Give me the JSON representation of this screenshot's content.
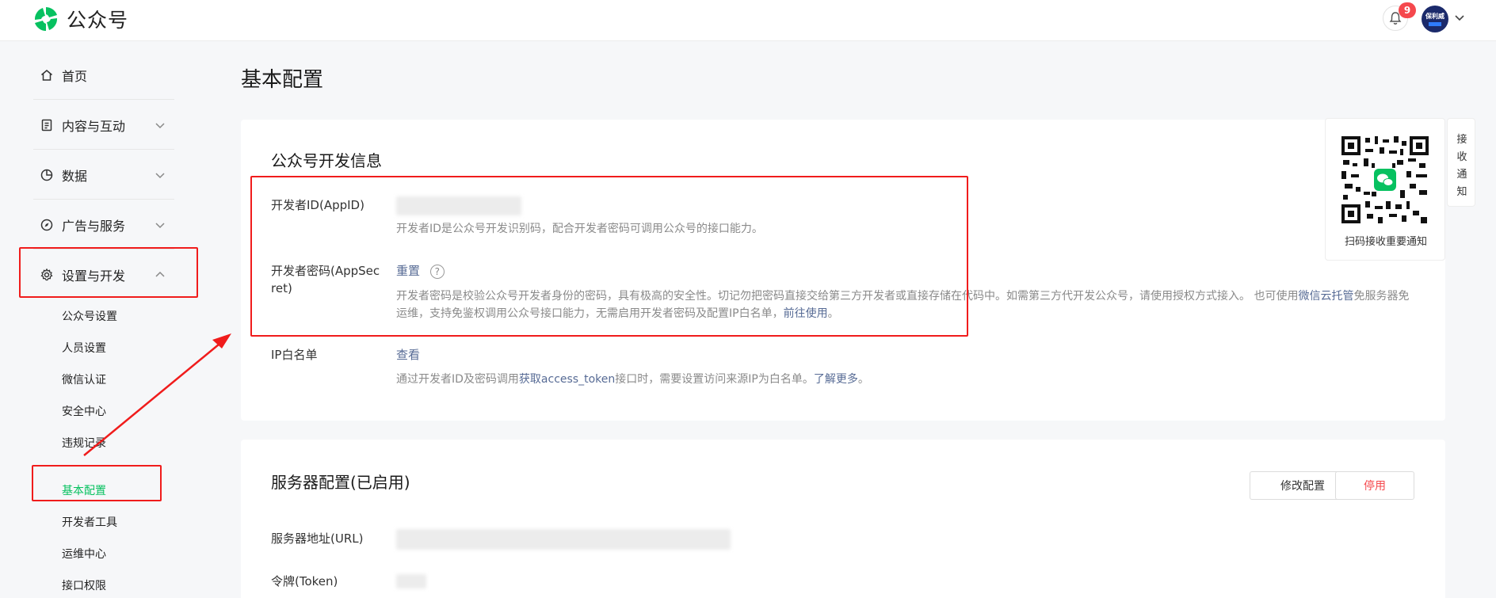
{
  "header": {
    "brand": "公众号",
    "notification_count": "9",
    "avatar_text": "保利威"
  },
  "sidebar": {
    "items": [
      {
        "label": "首页",
        "icon": "home-icon"
      },
      {
        "label": "内容与互动",
        "icon": "document-icon"
      },
      {
        "label": "数据",
        "icon": "pie-chart-icon"
      },
      {
        "label": "广告与服务",
        "icon": "compass-icon"
      },
      {
        "label": "设置与开发",
        "icon": "gear-icon"
      }
    ],
    "sub_items": [
      "公众号设置",
      "人员设置",
      "微信认证",
      "安全中心",
      "违规记录",
      "基本配置",
      "开发者工具",
      "运维中心",
      "接口权限"
    ],
    "active_sub_item": "基本配置"
  },
  "main": {
    "page_title": "基本配置",
    "dev_info": {
      "title": "公众号开发信息",
      "appid_label": "开发者ID(AppID)",
      "appid_desc": "开发者ID是公众号开发识别码，配合开发者密码可调用公众号的接口能力。",
      "secret_label_1": "开发者密码(AppSec",
      "secret_label_2": "ret)",
      "reset_link": "重置",
      "help_glyph": "?",
      "secret_desc_1a": "开发者密码是校验公众号开发者身份的密码，具有极高的安全性。切记勿把密码直接交给第三方开发者或直接存储在代码中。如需第三方代开发公众号，请使用授权方式接入。 也可使用",
      "secret_desc_1_link": "微信云托管",
      "secret_desc_1b": "免服务器免",
      "secret_desc_2a": "运维，支持免鉴权调用公众号接口能力，无需启用开发者密码及配置IP白名单，",
      "secret_desc_2_link": "前往使用",
      "secret_desc_2b": "。",
      "ip_label": "IP白名单",
      "ip_view_link": "查看",
      "ip_desc_a": "通过开发者ID及密码调用",
      "ip_desc_link1": "获取access_token",
      "ip_desc_b": "接口时，需要设置访问来源IP为白名单。",
      "ip_desc_link2": "了解更多",
      "ip_desc_c": "。"
    },
    "server": {
      "title": "服务器配置(已启用)",
      "modify_button": "修改配置",
      "disable_button": "停用",
      "url_label": "服务器地址(URL)",
      "token_label": "令牌(Token)"
    }
  },
  "qr_widget": {
    "caption": "扫码接收重要通知",
    "side_tab": [
      "接",
      "收",
      "通",
      "知"
    ]
  },
  "colors": {
    "accent_green": "#07c160",
    "link_blue": "#576b95",
    "annotation_red": "#f01c1c",
    "danger_text": "#f5484d"
  }
}
